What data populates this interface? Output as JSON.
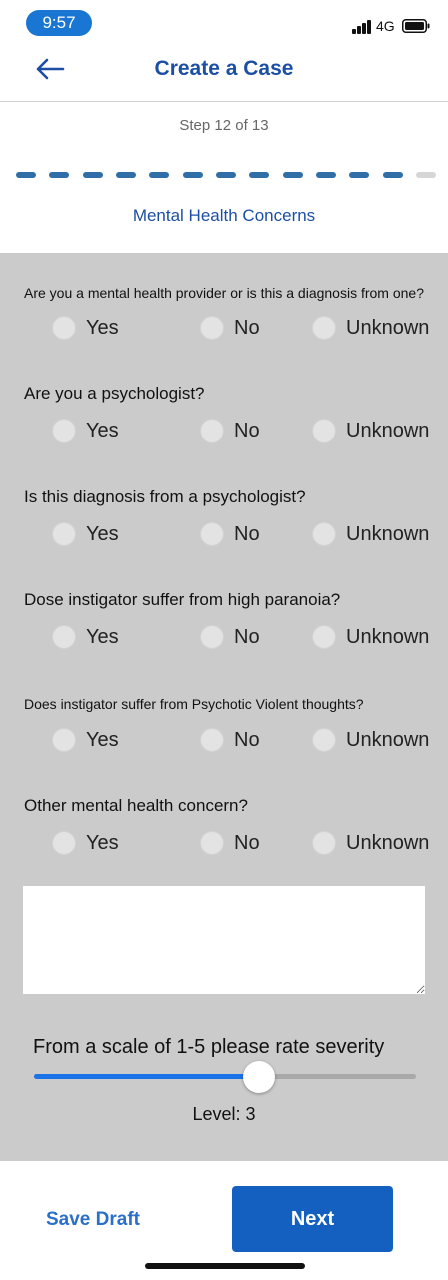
{
  "status_bar": {
    "time": "9:57",
    "network": "4G"
  },
  "header": {
    "title": "Create a Case"
  },
  "step": {
    "text": "Step 12 of 13",
    "current": 12,
    "total": 13
  },
  "section_title": "Mental Health Concerns",
  "options": [
    "Yes",
    "No",
    "Unknown"
  ],
  "questions": [
    {
      "text": "Are you a mental health provider or is this a diagnosis from one?",
      "selected": null
    },
    {
      "text": "Are you a psychologist?",
      "selected": null
    },
    {
      "text": "Is this diagnosis from a psychologist?",
      "selected": null
    },
    {
      "text": "Dose instigator suffer from high paranoia?",
      "selected": null
    },
    {
      "text": "Does instigator suffer from Psychotic Violent thoughts?",
      "selected": null
    },
    {
      "text": "Other mental health concern?",
      "selected": null
    }
  ],
  "other_concern_text": "",
  "severity": {
    "label": "From a scale of 1-5 please rate severity",
    "level_text": "Level: 3",
    "min": 1,
    "max": 5,
    "value": 3
  },
  "footer": {
    "save_draft": "Save Draft",
    "next": "Next"
  },
  "colors": {
    "primary": "#1460c1",
    "title_blue": "#1c4fa3",
    "progress_done": "#2f6ea7",
    "progress_todo": "#d6d6d6",
    "form_bg": "#cbcbcb",
    "slider": "#1a73e8"
  }
}
